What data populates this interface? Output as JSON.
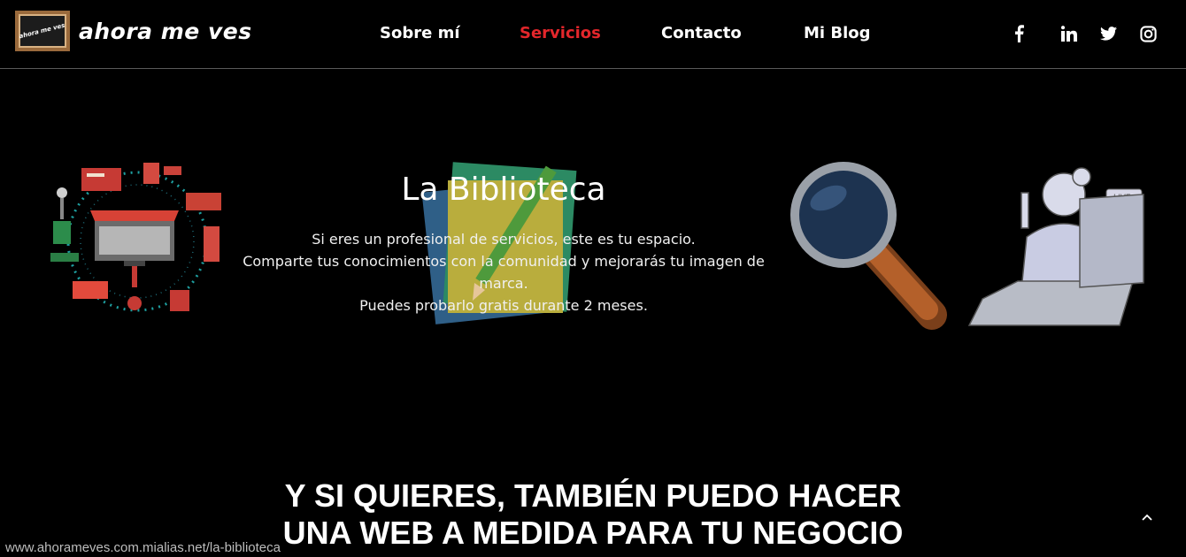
{
  "header": {
    "logo_text": "ahora me ves",
    "logo_mini": "ahora me ves",
    "nav": [
      {
        "label": "Sobre mí"
      },
      {
        "label": "Servicios",
        "active": true
      },
      {
        "label": "Contacto"
      },
      {
        "label": "Mi Blog"
      }
    ],
    "social": [
      "facebook-icon",
      "linkedin-icon",
      "twitter-icon",
      "instagram-icon"
    ]
  },
  "hero": {
    "title": "La Biblioteca",
    "lines": [
      "Si eres un profesional de servicios, este es tu espacio.",
      "Comparte tus conocimientos con la comunidad y mejorarás tu imagen de marca.",
      "Puedes probarlo gratis durante 2 meses."
    ]
  },
  "bottom": {
    "line1": "Y SI QUIERES, TAMBIÉN PUEDO HACER",
    "line2": "UNA WEB A MEDIDA PARA TU NEGOCIO"
  },
  "status_url": "www.ahorameves.com.mialias.net/la-biblioteca",
  "colors": {
    "accent": "#e3262b",
    "background": "#000000"
  }
}
